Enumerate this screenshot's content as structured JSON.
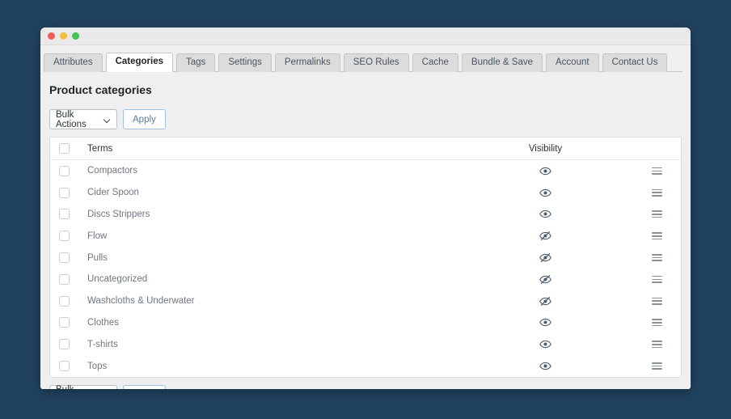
{
  "window": {
    "traffic_lights": [
      "close-button",
      "minimize-button",
      "maximize-button"
    ]
  },
  "tabs": [
    {
      "label": "Attributes",
      "active": false
    },
    {
      "label": "Categories",
      "active": true
    },
    {
      "label": "Tags",
      "active": false
    },
    {
      "label": "Settings",
      "active": false
    },
    {
      "label": "Permalinks",
      "active": false
    },
    {
      "label": "SEO Rules",
      "active": false
    },
    {
      "label": "Cache",
      "active": false
    },
    {
      "label": "Bundle & Save",
      "active": false
    },
    {
      "label": "Account",
      "active": false
    },
    {
      "label": "Contact Us",
      "active": false
    }
  ],
  "page_title": "Product categories",
  "toolbar": {
    "bulk_actions_label": "Bulk Actions",
    "apply_label": "Apply",
    "chevron_icon": "chevron-down-icon"
  },
  "table": {
    "columns": {
      "terms": "Terms",
      "visibility": "Visibility"
    },
    "select_all_checked": false,
    "rows": [
      {
        "term": "Compactors",
        "visible": true,
        "checked": false
      },
      {
        "term": "Cider Spoon",
        "visible": true,
        "checked": false
      },
      {
        "term": "Discs Strippers",
        "visible": true,
        "checked": false
      },
      {
        "term": "Flow",
        "visible": false,
        "checked": false
      },
      {
        "term": "Pulls",
        "visible": false,
        "checked": false
      },
      {
        "term": "Uncategorized",
        "visible": false,
        "checked": false
      },
      {
        "term": "Washcloths & Underwater",
        "visible": false,
        "checked": false
      },
      {
        "term": "Clothes",
        "visible": true,
        "checked": false
      },
      {
        "term": "T-shirts",
        "visible": true,
        "checked": false
      },
      {
        "term": "Tops",
        "visible": true,
        "checked": false
      }
    ],
    "icons": {
      "visible": "eye-icon",
      "hidden": "eye-off-icon",
      "handle": "drag-handle-icon",
      "checkbox": "checkbox-icon"
    }
  },
  "colors": {
    "background": "#21425e",
    "window_chrome": "#efefef",
    "accent_link": "#5b7d9c",
    "text_primary": "#1d2327",
    "text_muted": "#6f7780"
  }
}
